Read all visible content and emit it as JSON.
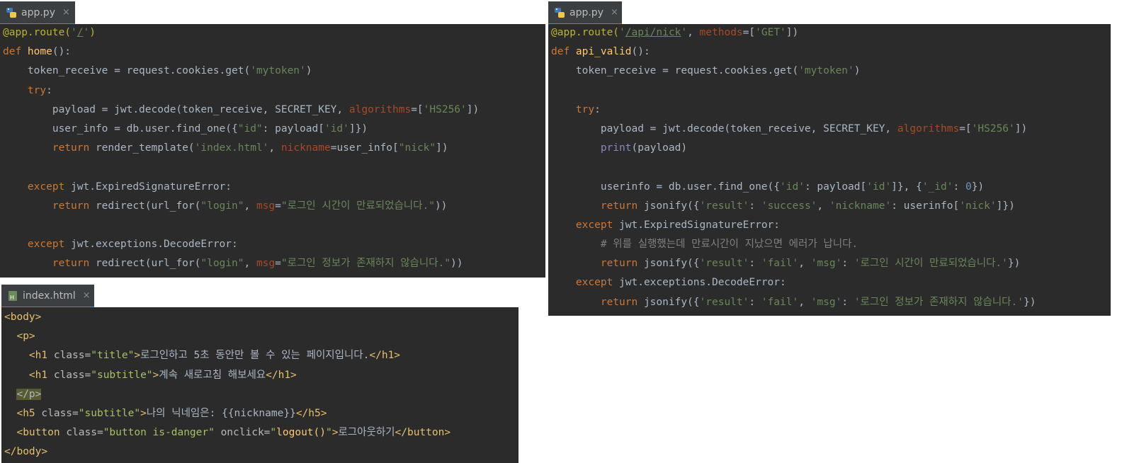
{
  "left_pane": {
    "tab": {
      "filename": "app.py",
      "close": "×",
      "icon": "python-file-icon"
    },
    "tokens": [
      [
        [
          "dec",
          "@app.route("
        ],
        [
          "str",
          "'"
        ],
        [
          "url",
          "/"
        ],
        [
          "str",
          "'"
        ],
        [
          "dec",
          ")"
        ]
      ],
      [
        [
          "kw",
          "def "
        ],
        [
          "fn",
          "home"
        ],
        [
          "text",
          "():"
        ]
      ],
      [
        [
          "text",
          "    token_receive = request.cookies.get("
        ],
        [
          "str",
          "'mytoken'"
        ],
        [
          "text",
          ")"
        ]
      ],
      [
        [
          "text",
          "    "
        ],
        [
          "kw",
          "try"
        ],
        [
          "text",
          ":"
        ]
      ],
      [
        [
          "text",
          "        payload = jwt.decode(token_receive, SECRET_KEY, "
        ],
        [
          "param",
          "algorithms"
        ],
        [
          "text",
          "=["
        ],
        [
          "str",
          "'HS256'"
        ],
        [
          "text",
          "])"
        ]
      ],
      [
        [
          "text",
          "        user_info = db.user.find_one({"
        ],
        [
          "str",
          "\"id\""
        ],
        [
          "text",
          ": payload["
        ],
        [
          "str",
          "'id'"
        ],
        [
          "text",
          "]})"
        ]
      ],
      [
        [
          "text",
          "        "
        ],
        [
          "kw",
          "return "
        ],
        [
          "text",
          "render_template("
        ],
        [
          "str",
          "'index.html'"
        ],
        [
          "text",
          ", "
        ],
        [
          "param",
          "nickname"
        ],
        [
          "text",
          "=user_info["
        ],
        [
          "str",
          "\"nick\""
        ],
        [
          "text",
          "])"
        ]
      ],
      [
        [
          "text",
          ""
        ]
      ],
      [
        [
          "text",
          "    "
        ],
        [
          "kw",
          "except "
        ],
        [
          "text",
          "jwt.ExpiredSignatureError:"
        ]
      ],
      [
        [
          "text",
          "        "
        ],
        [
          "kw",
          "return "
        ],
        [
          "text",
          "redirect(url_for("
        ],
        [
          "str",
          "\"login\""
        ],
        [
          "text",
          ", "
        ],
        [
          "param",
          "msg"
        ],
        [
          "text",
          "="
        ],
        [
          "str",
          "\"로그인 시간이 만료되었습니다.\""
        ],
        [
          "text",
          "))"
        ]
      ],
      [
        [
          "text",
          ""
        ]
      ],
      [
        [
          "text",
          "    "
        ],
        [
          "kw",
          "except "
        ],
        [
          "text",
          "jwt.exceptions.DecodeError:"
        ]
      ],
      [
        [
          "text",
          "        "
        ],
        [
          "kw",
          "return "
        ],
        [
          "text",
          "redirect(url_for("
        ],
        [
          "str",
          "\"login\""
        ],
        [
          "text",
          ", "
        ],
        [
          "param",
          "msg"
        ],
        [
          "text",
          "="
        ],
        [
          "str",
          "\"로그인 정보가 존재하지 않습니다.\""
        ],
        [
          "text",
          "))"
        ]
      ]
    ]
  },
  "right_pane": {
    "tab": {
      "filename": "app.py",
      "close": "×",
      "icon": "python-file-icon"
    },
    "tokens": [
      [
        [
          "dec",
          "@app.route("
        ],
        [
          "str",
          "'"
        ],
        [
          "url",
          "/api/nick"
        ],
        [
          "str",
          "'"
        ],
        [
          "text",
          ", "
        ],
        [
          "param",
          "methods"
        ],
        [
          "text",
          "=["
        ],
        [
          "str",
          "'GET'"
        ],
        [
          "text",
          "])"
        ]
      ],
      [
        [
          "kw",
          "def "
        ],
        [
          "fn",
          "api_valid"
        ],
        [
          "text",
          "():"
        ]
      ],
      [
        [
          "text",
          "    token_receive = request.cookies.get("
        ],
        [
          "str",
          "'mytoken'"
        ],
        [
          "text",
          ")"
        ]
      ],
      [
        [
          "text",
          ""
        ]
      ],
      [
        [
          "text",
          "    "
        ],
        [
          "kw",
          "try"
        ],
        [
          "text",
          ":"
        ]
      ],
      [
        [
          "text",
          "        payload = jwt.decode(token_receive, SECRET_KEY, "
        ],
        [
          "param",
          "algorithms"
        ],
        [
          "text",
          "=["
        ],
        [
          "str",
          "'HS256'"
        ],
        [
          "text",
          "])"
        ]
      ],
      [
        [
          "text",
          "        "
        ],
        [
          "builtin",
          "print"
        ],
        [
          "text",
          "(payload)"
        ]
      ],
      [
        [
          "text",
          ""
        ]
      ],
      [
        [
          "text",
          "        userinfo = db.user.find_one({"
        ],
        [
          "str",
          "'id'"
        ],
        [
          "text",
          ": payload["
        ],
        [
          "str",
          "'id'"
        ],
        [
          "text",
          "]}, {"
        ],
        [
          "str",
          "'_id'"
        ],
        [
          "text",
          ": "
        ],
        [
          "num",
          "0"
        ],
        [
          "text",
          "})"
        ]
      ],
      [
        [
          "text",
          "        "
        ],
        [
          "kw",
          "return "
        ],
        [
          "text",
          "jsonify({"
        ],
        [
          "str",
          "'result'"
        ],
        [
          "text",
          ": "
        ],
        [
          "str",
          "'success'"
        ],
        [
          "text",
          ", "
        ],
        [
          "str",
          "'nickname'"
        ],
        [
          "text",
          ": userinfo["
        ],
        [
          "str",
          "'nick'"
        ],
        [
          "text",
          "]})"
        ]
      ],
      [
        [
          "text",
          "    "
        ],
        [
          "kw",
          "except "
        ],
        [
          "text",
          "jwt.ExpiredSignatureError:"
        ]
      ],
      [
        [
          "com",
          "        # 위를 실행했는데 만료시간이 지났으면 에러가 납니다."
        ]
      ],
      [
        [
          "text",
          "        "
        ],
        [
          "kw",
          "return "
        ],
        [
          "text",
          "jsonify({"
        ],
        [
          "str",
          "'result'"
        ],
        [
          "text",
          ": "
        ],
        [
          "str",
          "'fail'"
        ],
        [
          "text",
          ", "
        ],
        [
          "str",
          "'msg'"
        ],
        [
          "text",
          ": "
        ],
        [
          "str",
          "'로그인 시간이 만료되었습니다.'"
        ],
        [
          "text",
          "})"
        ]
      ],
      [
        [
          "text",
          "    "
        ],
        [
          "kw",
          "except "
        ],
        [
          "text",
          "jwt.exceptions.DecodeError:"
        ]
      ],
      [
        [
          "text",
          "        "
        ],
        [
          "kw",
          "return "
        ],
        [
          "text",
          "jsonify({"
        ],
        [
          "str",
          "'result'"
        ],
        [
          "text",
          ": "
        ],
        [
          "str",
          "'fail'"
        ],
        [
          "text",
          ", "
        ],
        [
          "str",
          "'msg'"
        ],
        [
          "text",
          ": "
        ],
        [
          "str",
          "'로그인 정보가 존재하지 않습니다.'"
        ],
        [
          "text",
          "})"
        ]
      ]
    ]
  },
  "bottom_pane": {
    "tab": {
      "filename": "index.html",
      "close": "×",
      "icon": "html-file-icon"
    },
    "tokens": [
      [
        [
          "tag",
          "<body>"
        ]
      ],
      [
        [
          "text",
          "  "
        ],
        [
          "tag",
          "<p>"
        ]
      ],
      [
        [
          "text",
          "    "
        ],
        [
          "tag",
          "<h1 "
        ],
        [
          "attr",
          "class="
        ],
        [
          "aval",
          "\"title\""
        ],
        [
          "tag",
          ">"
        ],
        [
          "text",
          "로그인하고 5초 동안만 볼 수 있는 페이지입니다."
        ],
        [
          "tag",
          "</h1>"
        ]
      ],
      [
        [
          "text",
          "    "
        ],
        [
          "tag",
          "<h1 "
        ],
        [
          "attr",
          "class="
        ],
        [
          "aval",
          "\"subtitle\""
        ],
        [
          "tag",
          ">"
        ],
        [
          "text",
          "계속 새로고침 해보세요"
        ],
        [
          "tag",
          "</h1>"
        ]
      ],
      [
        [
          "text",
          "  "
        ],
        [
          "hl",
          "</p>"
        ]
      ],
      [
        [
          "text",
          "  "
        ],
        [
          "tag",
          "<h5 "
        ],
        [
          "attr",
          "class="
        ],
        [
          "aval",
          "\"subtitle\""
        ],
        [
          "tag",
          ">"
        ],
        [
          "text",
          "나의 닉네임은: {{nickname}}"
        ],
        [
          "tag",
          "</h5>"
        ]
      ],
      [
        [
          "text",
          "  "
        ],
        [
          "tag",
          "<button "
        ],
        [
          "attr",
          "class="
        ],
        [
          "aval",
          "\"button is-danger\""
        ],
        [
          "attr",
          " onclick="
        ],
        [
          "aval",
          "\""
        ],
        [
          "fn",
          "logout()"
        ],
        [
          "aval",
          "\""
        ],
        [
          "tag",
          ">"
        ],
        [
          "text",
          "로그아웃하기"
        ],
        [
          "tag",
          "</button>"
        ]
      ],
      [
        [
          "tag",
          "</body>"
        ]
      ]
    ]
  }
}
